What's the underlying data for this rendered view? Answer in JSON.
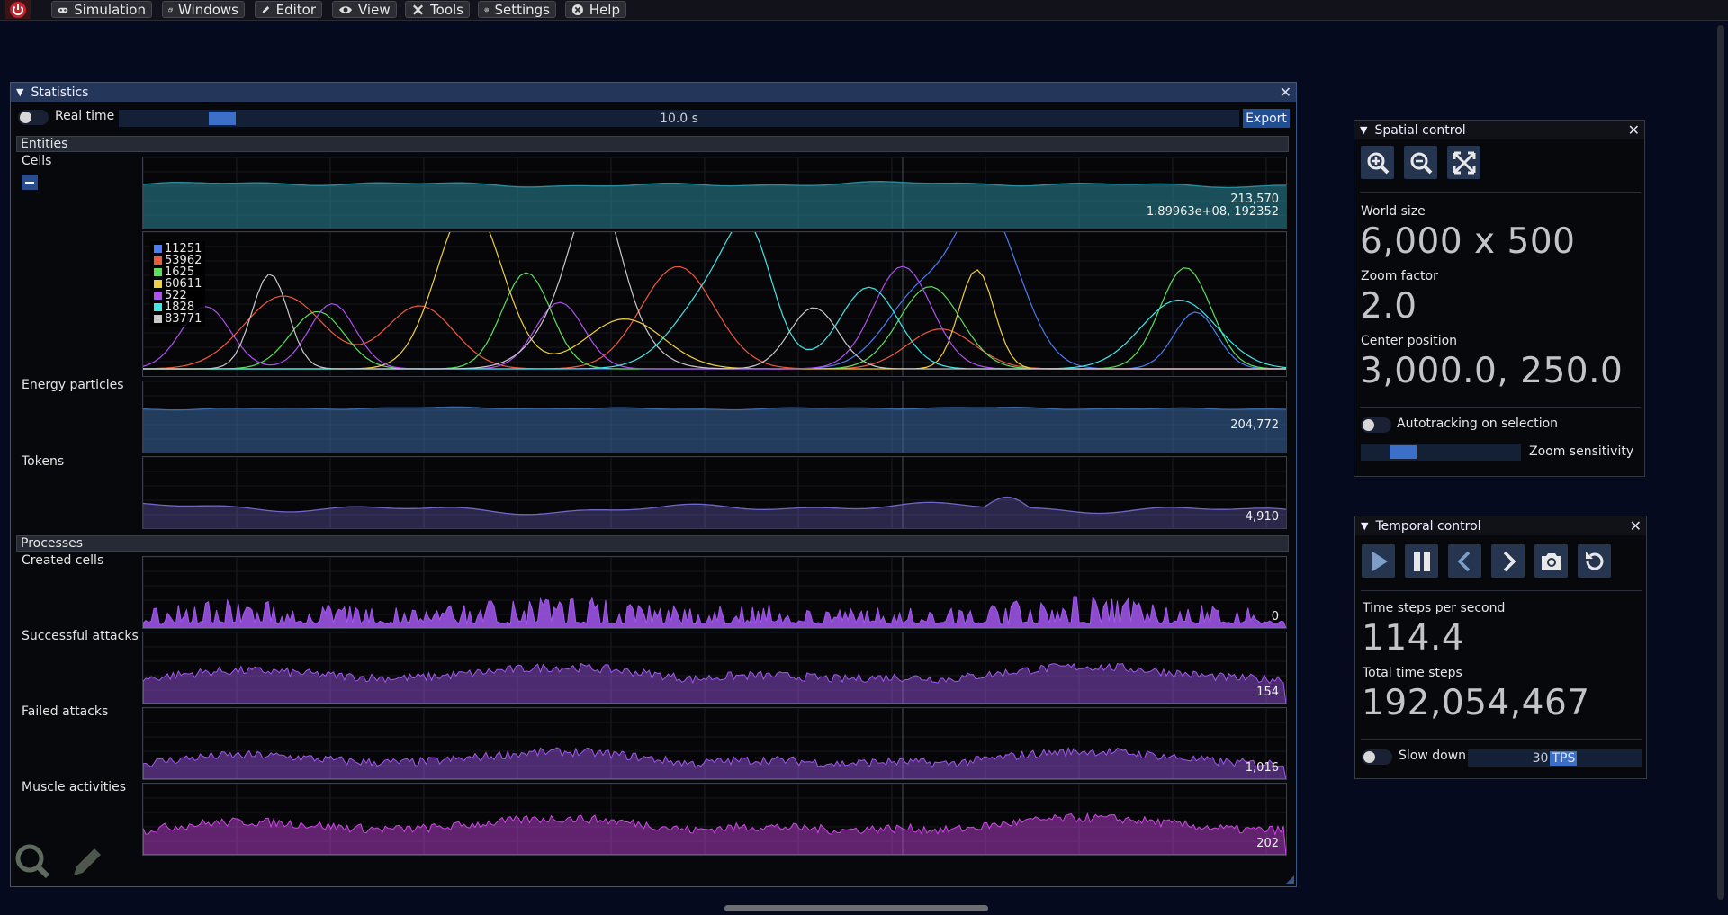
{
  "menu": {
    "items": [
      {
        "label": "Simulation",
        "icon": "gamepad-icon"
      },
      {
        "label": "Windows",
        "icon": "windows-icon"
      },
      {
        "label": "Editor",
        "icon": "pencil-icon"
      },
      {
        "label": "View",
        "icon": "eye-icon"
      },
      {
        "label": "Tools",
        "icon": "tools-icon"
      },
      {
        "label": "Settings",
        "icon": "gear-icon"
      },
      {
        "label": "Help",
        "icon": "help-icon"
      }
    ]
  },
  "statistics": {
    "title": "Statistics",
    "realtime_label": "Real time",
    "timespan_value": "10.0 s",
    "timespan_fraction": 0.08,
    "export_label": "Export",
    "entities_header": "Entities",
    "processes_header": "Processes",
    "rows": {
      "cells": {
        "label": "Cells",
        "value": "213,570",
        "value2": "1.89963e+08, 192352"
      },
      "energy": {
        "label": "Energy particles",
        "value": "204,772"
      },
      "tokens": {
        "label": "Tokens",
        "value": "4,910"
      },
      "created": {
        "label": "Created cells",
        "value": "0"
      },
      "attacks": {
        "label": "Successful attacks",
        "value": "154"
      },
      "failed": {
        "label": "Failed attacks",
        "value": "1,016"
      },
      "muscle": {
        "label": "Muscle activities",
        "value": "202"
      }
    },
    "legend": [
      {
        "value": "11251",
        "color": "#4c7cf0"
      },
      {
        "value": "53962",
        "color": "#f05a3c"
      },
      {
        "value": "1625",
        "color": "#5ae05a"
      },
      {
        "value": "60611",
        "color": "#f0d040"
      },
      {
        "value": "522",
        "color": "#b050f0"
      },
      {
        "value": "1828",
        "color": "#40e8e8"
      },
      {
        "value": "83771",
        "color": "#c8c8c8"
      }
    ]
  },
  "spatial": {
    "title": "Spatial control",
    "world_size_label": "World size",
    "world_size": "6,000 x 500",
    "zoom_label": "Zoom factor",
    "zoom": "2.0",
    "center_label": "Center position",
    "center": "3,000.0, 250.0",
    "autotracking_label": "Autotracking on selection",
    "zoom_sensitivity_label": "Zoom sensitivity",
    "zoom_sensitivity_fraction": 0.18
  },
  "temporal": {
    "title": "Temporal control",
    "tps_label": "Time steps per second",
    "tps": "114.4",
    "total_label": "Total time steps",
    "total": "192,054,467",
    "slowdown_label": "Slow down",
    "slowdown_value": "30",
    "slowdown_unit": "TPS"
  },
  "colors": {
    "cells": "#2b8c9c",
    "energy": "#3a6aa6",
    "tokens": "#6f67c8",
    "processes": "#a458f0",
    "muscle": "#d048e8"
  }
}
